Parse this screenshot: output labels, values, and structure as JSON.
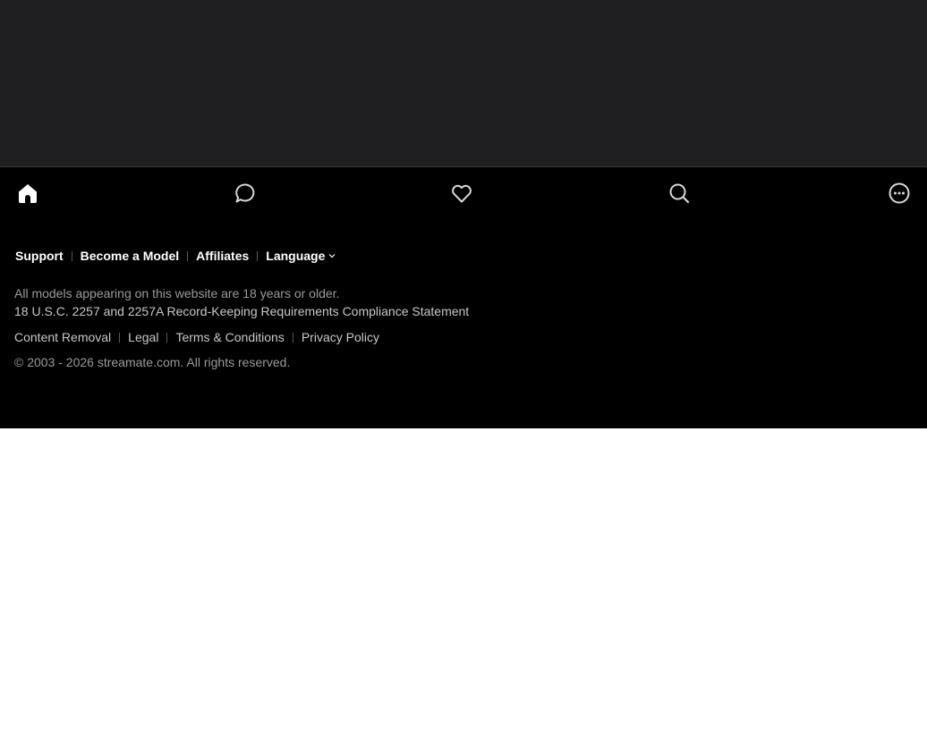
{
  "nav": {
    "items": [
      {
        "icon": "home-icon",
        "active": true
      },
      {
        "icon": "chat-icon",
        "active": false
      },
      {
        "icon": "heart-icon",
        "active": false
      },
      {
        "icon": "search-icon",
        "active": false
      },
      {
        "icon": "more-icon",
        "active": false
      }
    ]
  },
  "footer": {
    "links": {
      "support": "Support",
      "become_model": "Become a Model",
      "affiliates": "Affiliates",
      "language": "Language"
    },
    "age_notice": "All models appearing on this website are 18 years or older.",
    "compliance": "18 U.S.C. 2257 and 2257A Record-Keeping Requirements Compliance Statement",
    "legal_links": {
      "content_removal": "Content Removal",
      "legal": "Legal",
      "terms": "Terms & Conditions",
      "privacy": "Privacy Policy"
    },
    "copyright": "© 2003 - 2026 streamate.com. All rights reserved."
  },
  "colors": {
    "top_area": "#1f1f21",
    "footer_bg": "#000000",
    "text_primary": "#ffffff",
    "text_muted": "#9a9a9a"
  }
}
